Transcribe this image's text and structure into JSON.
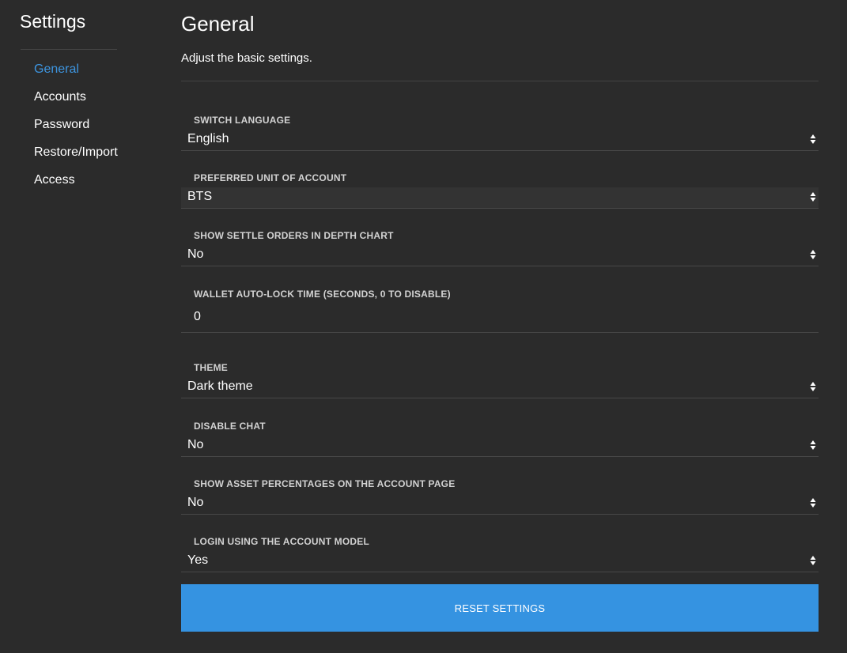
{
  "sidebar": {
    "title": "Settings",
    "items": [
      {
        "label": "General"
      },
      {
        "label": "Accounts"
      },
      {
        "label": "Password"
      },
      {
        "label": "Restore/Import"
      },
      {
        "label": "Access"
      }
    ],
    "active_color": "#3d95e0"
  },
  "main": {
    "title": "General",
    "subtitle": "Adjust the basic settings.",
    "settings": [
      {
        "label": "SWITCH LANGUAGE",
        "value": "English"
      },
      {
        "label": "PREFERRED UNIT OF ACCOUNT",
        "value": "BTS"
      },
      {
        "label": "SHOW SETTLE ORDERS IN DEPTH CHART",
        "value": "No"
      },
      {
        "label": "WALLET AUTO-LOCK TIME (SECONDS, 0 TO DISABLE)",
        "value": "0"
      },
      {
        "label": "THEME",
        "value": "Dark theme"
      },
      {
        "label": "DISABLE CHAT",
        "value": "No"
      },
      {
        "label": "SHOW ASSET PERCENTAGES ON THE ACCOUNT PAGE",
        "value": "No"
      },
      {
        "label": "LOGIN USING THE ACCOUNT MODEL",
        "value": "Yes"
      }
    ],
    "reset_label": "RESET SETTINGS"
  },
  "colors": {
    "background": "#2b2b2b",
    "accent": "#3593e1",
    "label": "#d2d2d2"
  }
}
